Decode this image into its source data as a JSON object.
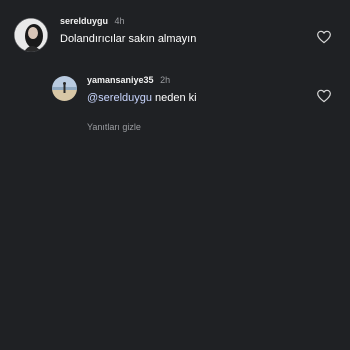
{
  "comments": [
    {
      "username": "serelduygu",
      "time": "4h",
      "text": "Dolandırıcılar sakın almayın",
      "like_icon": "heart-outline-icon"
    }
  ],
  "reply": {
    "username": "yamansaniye35",
    "time": "2h",
    "mention": "@serelduygu",
    "text": " neden ki",
    "like_icon": "heart-outline-icon"
  },
  "hide_replies_label": "Yanıtları gizle",
  "colors": {
    "background": "#1f2124",
    "text_primary": "#ffffff",
    "text_secondary": "#9a9ca0",
    "mention": "#c9d6ff"
  }
}
